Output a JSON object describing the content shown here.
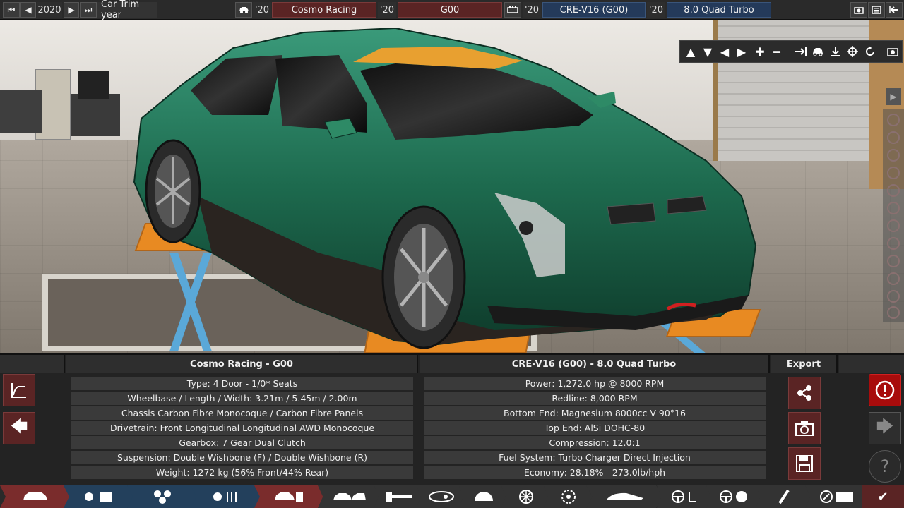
{
  "topbar": {
    "year": "2020",
    "trim_year_label": "Car Trim year",
    "car_year": "'20",
    "brand": "Cosmo Racing",
    "model_year": "'20",
    "model": "G00",
    "engine_year": "'20",
    "engine": "CRE-V16 (G00)",
    "variant_year": "'20",
    "variant": "8.0 Quad Turbo"
  },
  "left_column": {
    "title": "Cosmo Racing - G00",
    "rows": [
      "Type: 4 Door - 1/0* Seats",
      "Wheelbase / Length / Width: 3.21m / 5.45m / 2.00m",
      "Chassis Carbon Fibre Monocoque / Carbon Fibre Panels",
      "Drivetrain: Front Longitudinal Longitudinal AWD Monocoque",
      "Gearbox: 7 Gear Dual Clutch",
      "Suspension: Double Wishbone (F) / Double Wishbone (R)",
      "Weight: 1272 kg (56% Front/44% Rear)"
    ]
  },
  "right_column": {
    "title": "CRE-V16 (G00) - 8.0 Quad Turbo",
    "rows": [
      "Power: 1,272.0 hp @ 8000 RPM",
      "Redline:  8,000 RPM",
      "Bottom End: Magnesium 8000cc V 90°16",
      "Top End: AlSi DOHC-80",
      "Compression: 12.0:1",
      "Fuel System: Turbo Charger Direct Injection",
      "Economy: 28.18% - 273.0lb/hph"
    ]
  },
  "export": {
    "title": "Export"
  },
  "icons": {
    "first": "⏮",
    "prev": "◀",
    "next": "▶",
    "last": "⏭",
    "up": "▲",
    "down": "▼",
    "left": "◀",
    "right": "▶",
    "plus": "✚",
    "minus": "━",
    "camera": "📷",
    "back": "🡄",
    "forward": "🡆",
    "help": "?",
    "alert": "!",
    "check": "✔"
  },
  "colors": {
    "car_body": "#1f6b4f",
    "accent_red": "#7a2c2c",
    "accent_blue": "#23405c",
    "alert": "#a80c0c"
  }
}
